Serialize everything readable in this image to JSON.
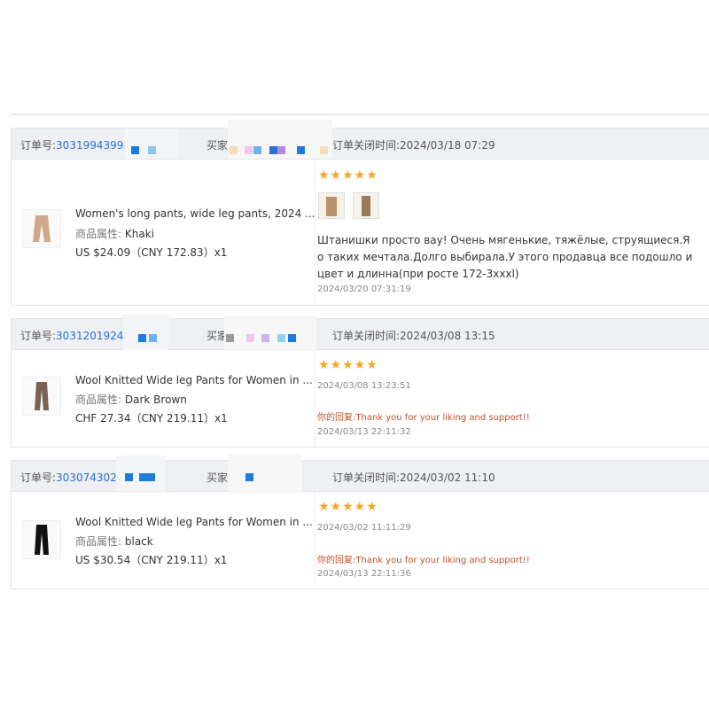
{
  "labels": {
    "order_no": "订单号:",
    "buyer": "买家",
    "closed_prefix": "订单关闭时间:",
    "attr_key": "商品属性:",
    "reply_prefix": "你的回复:"
  },
  "colors": {
    "link": "#2a6fd6",
    "star": "#f5a623",
    "reply": "#c0502a"
  },
  "orders": [
    {
      "order_no": "30319943993",
      "closed_time": "订单关闭时间:2024/03/18 07:29",
      "title": "Women's long pants, wide leg pants, 2024 ...",
      "attr_value": "Khaki",
      "price": "US $24.09（CNY  172.83）x1",
      "stars": "★★★★★",
      "review_text": "Штанишки просто вау! Очень мягенькие, тяжёлые, струящиеся.Я о таких мечтала.Долго выбирала.У этого продавца все подошло и цвет и длинна(при росте 172-3xxxl)",
      "review_time": "2024/03/20 07:31:19"
    },
    {
      "order_no": "3031201924",
      "closed_time": "订单关闭时间:2024/03/08 13:15",
      "title": "Wool Knitted Wide leg Pants for Women in ...",
      "attr_value": "Dark Brown",
      "price": "CHF 27.34（CNY  219.11）x1",
      "stars": "★★★★★",
      "review_time": "2024/03/08 13:23:51",
      "reply_label": "你的回复:",
      "reply_text": "Thank you for your liking and support!!",
      "reply_time": "2024/03/13 22:11:32"
    },
    {
      "order_no": "3030743026",
      "closed_time": "订单关闭时间:2024/03/02 11:10",
      "title": "Wool Knitted Wide leg Pants for Women in ...",
      "attr_value": "black",
      "price": "US $30.54（CNY  219.11）x1",
      "stars": "★★★★★",
      "review_time": "2024/03/02 11:11:29",
      "reply_label": "你的回复:",
      "reply_text": "Thank you for your liking and support!!",
      "reply_time": "2024/03/13 22:11:36"
    }
  ]
}
